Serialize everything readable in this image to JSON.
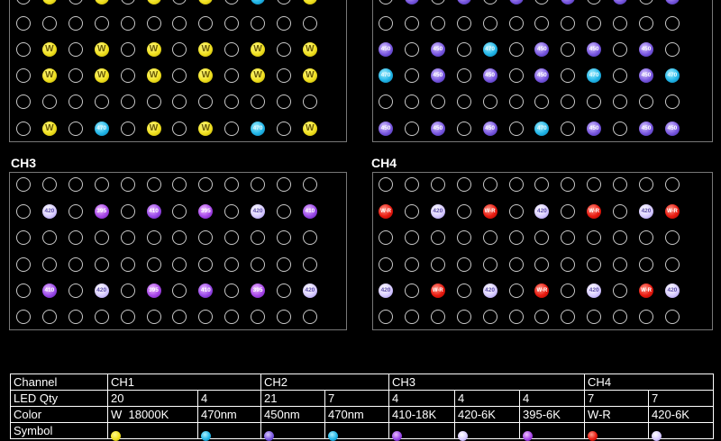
{
  "channels": [
    {
      "id": "ch1",
      "label": "",
      "rows": [
        "E W E W E W E W E B E W",
        "E E E E E E E E E E E E",
        "E W E W E W E W E W E W",
        "E W E W E W E W E W E W",
        "E E E E E E E E E E E E",
        "E W E B E W E W E B E W"
      ]
    },
    {
      "id": "ch2",
      "label": "",
      "rows": [
        "E 4 E 4 E 4 E 4 E 4 E 4",
        "E E E E E E E E E E E E",
        "4 E 4 E B E 4 E 4 E 4 E",
        "B E 4 E 4 E 4 E B E 4 B",
        "E E E E E E E E E E E E",
        "4 E 4 E 4 E B E 4 E 4 4"
      ]
    },
    {
      "id": "ch3",
      "label": "CH3",
      "rows": [
        "E E E E E E E E E E E E",
        "E 2 E 3 E 1 E 3 E 2 E 1",
        "E E E E E E E E E E E E",
        "E E E E E E E E E E E E",
        "E 1 E 2 E 3 E 1 E 3 E 2",
        "E E E E E E E E E E E E"
      ]
    },
    {
      "id": "ch4",
      "label": "CH4",
      "rows": [
        "E E E E E E E E E E E E",
        "R E 2 E R E 2 E R E 2 R",
        "E E E E E E E E E E E E",
        "E E E E E E E E E E E E",
        "2 E R E 2 E R E 2 E R 2",
        "E E E E E E E E E E E E"
      ]
    }
  ],
  "led_text": {
    "W": "W",
    "B": "470",
    "4": "450",
    "2": "420",
    "1": "410",
    "3": "395",
    "R": "W-R"
  },
  "table": {
    "row_channel": [
      "Channel",
      "CH1",
      "CH2",
      "CH3",
      "CH4"
    ],
    "row_qty": [
      "LED Qty",
      "20",
      "4",
      "21",
      "7",
      "4",
      "4",
      "4",
      "7",
      "7"
    ],
    "row_color": [
      "Color",
      "W  18000K",
      "470nm",
      "450nm",
      "470nm",
      "410-18K",
      "420-6K",
      "395-6K",
      "W-R",
      "420-6K"
    ],
    "row_symbol_label": "Symbol",
    "row_symbol": [
      "w",
      "b470",
      "b450",
      "b470",
      "p410",
      "p420",
      "p395",
      "wr",
      "p420"
    ]
  },
  "colors": {
    "background": "#000000",
    "panel_border": "#777777",
    "empty_ring": "#c8c8c8"
  }
}
